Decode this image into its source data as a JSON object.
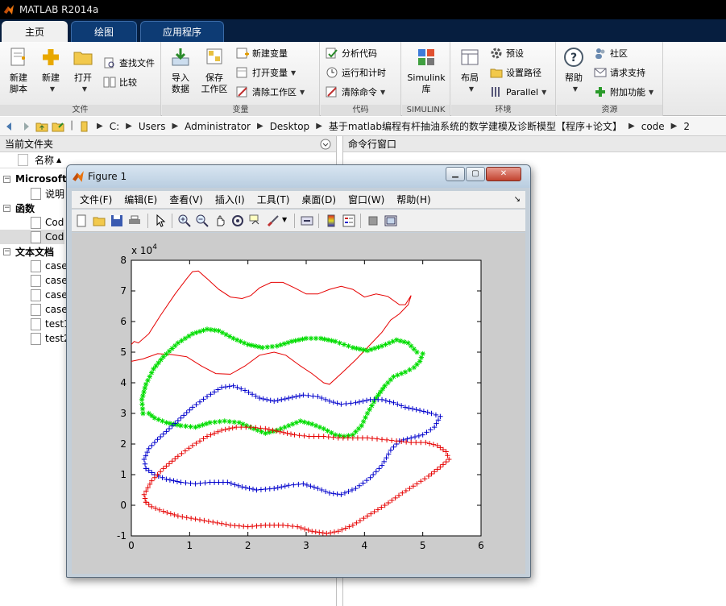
{
  "app": {
    "title": "MATLAB R2014a"
  },
  "tabs": [
    {
      "label": "主页"
    },
    {
      "label": "绘图"
    },
    {
      "label": "应用程序"
    }
  ],
  "ribbon": {
    "file": {
      "label": "文件",
      "new_script": [
        "新建",
        "脚本"
      ],
      "new": "新建",
      "open": "打开",
      "find_files": "查找文件",
      "compare": "比较"
    },
    "variable": {
      "label": "变量",
      "import": [
        "导入",
        "数据"
      ],
      "save": [
        "保存",
        "工作区"
      ],
      "new_var": "新建变量",
      "open_var": "打开变量",
      "clear_ws": "清除工作区"
    },
    "code": {
      "label": "代码",
      "analyze": "分析代码",
      "run_time": "运行和计时",
      "clear_cmd": "清除命令"
    },
    "simulink": {
      "label": "SIMULINK",
      "btn": [
        "Simulink",
        "库"
      ]
    },
    "env": {
      "label": "环境",
      "layout": "布局",
      "prefs": "预设",
      "set_path": "设置路径",
      "parallel": "Parallel"
    },
    "resources": {
      "label": "资源",
      "help": "帮助",
      "community": "社区",
      "support": "请求支持",
      "addons": "附加功能"
    }
  },
  "address": {
    "crumbs": [
      "C:",
      "Users",
      "Administrator",
      "Desktop",
      "基于matlab编程有杆抽油系统的数学建模及诊断模型【程序+论文】",
      "code",
      "2"
    ]
  },
  "left_panel": {
    "title": "当前文件夹",
    "column": "名称",
    "rows": [
      {
        "label": "Microsoft",
        "bold": true,
        "level": 0
      },
      {
        "label": "说明",
        "level": 1
      },
      {
        "label": "函数",
        "bold": true,
        "level": 0
      },
      {
        "label": "Cod",
        "level": 1
      },
      {
        "label": "Cod",
        "level": 1,
        "selected": true
      },
      {
        "label": "文本文档",
        "bold": true,
        "level": 0
      },
      {
        "label": "case",
        "level": 1
      },
      {
        "label": "case",
        "level": 1
      },
      {
        "label": "case",
        "level": 1
      },
      {
        "label": "case",
        "level": 1
      },
      {
        "label": "test1",
        "level": 1
      },
      {
        "label": "test2",
        "level": 1
      }
    ]
  },
  "right_panel": {
    "title": "命令行窗口"
  },
  "figure": {
    "title": "Figure 1",
    "menu": [
      "文件(F)",
      "编辑(E)",
      "查看(V)",
      "插入(I)",
      "工具(T)",
      "桌面(D)",
      "窗口(W)",
      "帮助(H)"
    ],
    "toolbar_icons": [
      "new-figure-icon",
      "open-file-icon",
      "save-icon",
      "print-icon",
      "pointer-icon",
      "zoom-in-icon",
      "zoom-out-icon",
      "pan-icon",
      "rotate-icon",
      "data-cursor-icon",
      "brush-icon",
      "link-icon",
      "colorbar-icon",
      "legend-icon",
      "hide-plot-tools-icon",
      "show-plot-tools-icon"
    ]
  },
  "colors": {
    "red": "#e60000",
    "green": "#00dd00",
    "blue": "#0000cc",
    "matlab_orange": "#e8730f"
  },
  "chart_data": {
    "type": "line",
    "title": "",
    "xlabel": "",
    "ylabel": "",
    "y_exponent": "x 10^4",
    "xlim": [
      0,
      6
    ],
    "ylim": [
      -1,
      8
    ],
    "xticks": [
      0,
      1,
      2,
      3,
      4,
      5,
      6
    ],
    "yticks": [
      -1,
      0,
      1,
      2,
      3,
      4,
      5,
      6,
      7,
      8
    ],
    "grid": false,
    "series": [
      {
        "marker": "line",
        "color": "#e60000",
        "points": [
          [
            0,
            5.25
          ],
          [
            0.05,
            5.35
          ],
          [
            0.12,
            5.3
          ],
          [
            0.3,
            5.6
          ],
          [
            0.5,
            6.2
          ],
          [
            0.75,
            6.9
          ],
          [
            0.95,
            7.4
          ],
          [
            1.05,
            7.63
          ],
          [
            1.15,
            7.65
          ],
          [
            1.3,
            7.4
          ],
          [
            1.5,
            7.05
          ],
          [
            1.7,
            6.8
          ],
          [
            1.9,
            6.75
          ],
          [
            2.05,
            6.85
          ],
          [
            2.2,
            7.1
          ],
          [
            2.4,
            7.28
          ],
          [
            2.6,
            7.28
          ],
          [
            2.8,
            7.1
          ],
          [
            3.0,
            6.9
          ],
          [
            3.2,
            6.9
          ],
          [
            3.4,
            7.05
          ],
          [
            3.6,
            7.15
          ],
          [
            3.8,
            7.05
          ],
          [
            4.0,
            6.8
          ],
          [
            4.2,
            6.9
          ],
          [
            4.4,
            6.82
          ],
          [
            4.6,
            6.55
          ],
          [
            4.7,
            6.55
          ],
          [
            4.8,
            6.85
          ],
          [
            4.75,
            6.55
          ],
          [
            4.6,
            6.25
          ],
          [
            4.45,
            6.05
          ],
          [
            4.3,
            5.65
          ],
          [
            4.1,
            5.25
          ],
          [
            3.85,
            4.75
          ],
          [
            3.6,
            4.3
          ],
          [
            3.4,
            3.95
          ],
          [
            3.3,
            4.0
          ],
          [
            3.1,
            4.3
          ],
          [
            2.9,
            4.55
          ],
          [
            2.65,
            4.9
          ],
          [
            2.45,
            5.0
          ],
          [
            2.2,
            4.9
          ],
          [
            1.95,
            4.55
          ],
          [
            1.7,
            4.28
          ],
          [
            1.45,
            4.3
          ],
          [
            1.2,
            4.55
          ],
          [
            0.95,
            4.85
          ],
          [
            0.7,
            4.92
          ],
          [
            0.45,
            4.95
          ],
          [
            0.2,
            4.78
          ],
          [
            0,
            4.7
          ]
        ]
      },
      {
        "marker": "asterisk",
        "color": "#00dd00",
        "points": [
          [
            0.2,
            3.0
          ],
          [
            0.3,
            3.0
          ],
          [
            0.4,
            2.85
          ],
          [
            0.6,
            2.7
          ],
          [
            0.85,
            2.6
          ],
          [
            1.1,
            2.55
          ],
          [
            1.35,
            2.7
          ],
          [
            1.6,
            2.75
          ],
          [
            1.85,
            2.7
          ],
          [
            2.1,
            2.5
          ],
          [
            2.3,
            2.35
          ],
          [
            2.5,
            2.45
          ],
          [
            2.7,
            2.6
          ],
          [
            2.9,
            2.75
          ],
          [
            3.1,
            2.65
          ],
          [
            3.3,
            2.5
          ],
          [
            3.5,
            2.3
          ],
          [
            3.65,
            2.25
          ],
          [
            3.8,
            2.3
          ],
          [
            3.95,
            2.6
          ],
          [
            4.05,
            3.0
          ],
          [
            4.2,
            3.5
          ],
          [
            4.35,
            3.9
          ],
          [
            4.5,
            4.2
          ],
          [
            4.7,
            4.35
          ],
          [
            4.85,
            4.5
          ],
          [
            4.95,
            4.7
          ],
          [
            5.0,
            4.95
          ],
          [
            4.9,
            5.0
          ],
          [
            4.75,
            5.3
          ],
          [
            4.55,
            5.4
          ],
          [
            4.3,
            5.2
          ],
          [
            4.05,
            5.05
          ],
          [
            3.8,
            5.15
          ],
          [
            3.5,
            5.35
          ],
          [
            3.25,
            5.45
          ],
          [
            3.0,
            5.45
          ],
          [
            2.75,
            5.35
          ],
          [
            2.5,
            5.2
          ],
          [
            2.25,
            5.15
          ],
          [
            2.0,
            5.25
          ],
          [
            1.75,
            5.45
          ],
          [
            1.5,
            5.7
          ],
          [
            1.3,
            5.75
          ],
          [
            1.05,
            5.6
          ],
          [
            0.8,
            5.3
          ],
          [
            0.55,
            4.85
          ],
          [
            0.38,
            4.45
          ],
          [
            0.25,
            3.95
          ],
          [
            0.18,
            3.45
          ],
          [
            0.2,
            3.0
          ]
        ]
      },
      {
        "marker": "plus",
        "color": "#0000cc",
        "points": [
          [
            0.25,
            1.2
          ],
          [
            0.22,
            1.5
          ],
          [
            0.3,
            1.85
          ],
          [
            0.45,
            2.15
          ],
          [
            0.65,
            2.5
          ],
          [
            0.85,
            2.85
          ],
          [
            1.05,
            3.2
          ],
          [
            1.3,
            3.55
          ],
          [
            1.55,
            3.85
          ],
          [
            1.75,
            3.9
          ],
          [
            1.95,
            3.75
          ],
          [
            2.2,
            3.5
          ],
          [
            2.45,
            3.4
          ],
          [
            2.7,
            3.5
          ],
          [
            2.95,
            3.6
          ],
          [
            3.2,
            3.55
          ],
          [
            3.4,
            3.4
          ],
          [
            3.6,
            3.3
          ],
          [
            3.85,
            3.35
          ],
          [
            4.1,
            3.45
          ],
          [
            4.3,
            3.45
          ],
          [
            4.5,
            3.35
          ],
          [
            4.7,
            3.2
          ],
          [
            4.95,
            3.1
          ],
          [
            5.15,
            3.0
          ],
          [
            5.3,
            2.9
          ],
          [
            5.2,
            2.55
          ],
          [
            5.0,
            2.3
          ],
          [
            4.8,
            2.2
          ],
          [
            4.6,
            2.1
          ],
          [
            4.45,
            1.8
          ],
          [
            4.3,
            1.3
          ],
          [
            4.1,
            0.9
          ],
          [
            3.85,
            0.55
          ],
          [
            3.6,
            0.35
          ],
          [
            3.4,
            0.4
          ],
          [
            3.2,
            0.55
          ],
          [
            2.95,
            0.7
          ],
          [
            2.7,
            0.65
          ],
          [
            2.45,
            0.55
          ],
          [
            2.15,
            0.5
          ],
          [
            1.9,
            0.6
          ],
          [
            1.65,
            0.75
          ],
          [
            1.35,
            0.75
          ],
          [
            1.1,
            0.7
          ],
          [
            0.85,
            0.75
          ],
          [
            0.6,
            0.85
          ],
          [
            0.4,
            1.0
          ],
          [
            0.25,
            1.2
          ]
        ]
      },
      {
        "marker": "plus",
        "color": "#e60000",
        "points": [
          [
            0.25,
            0.1
          ],
          [
            0.22,
            0.35
          ],
          [
            0.35,
            0.8
          ],
          [
            0.55,
            1.2
          ],
          [
            0.8,
            1.6
          ],
          [
            1.05,
            1.95
          ],
          [
            1.3,
            2.25
          ],
          [
            1.55,
            2.45
          ],
          [
            1.8,
            2.55
          ],
          [
            2.05,
            2.55
          ],
          [
            2.3,
            2.5
          ],
          [
            2.55,
            2.4
          ],
          [
            2.8,
            2.3
          ],
          [
            3.05,
            2.25
          ],
          [
            3.3,
            2.25
          ],
          [
            3.55,
            2.2
          ],
          [
            3.8,
            2.2
          ],
          [
            4.05,
            2.2
          ],
          [
            4.3,
            2.15
          ],
          [
            4.55,
            2.1
          ],
          [
            4.8,
            2.05
          ],
          [
            5.05,
            2.05
          ],
          [
            5.25,
            1.95
          ],
          [
            5.4,
            1.75
          ],
          [
            5.45,
            1.5
          ],
          [
            5.3,
            1.25
          ],
          [
            5.1,
            0.95
          ],
          [
            4.9,
            0.7
          ],
          [
            4.65,
            0.4
          ],
          [
            4.35,
            0.0
          ],
          [
            4.05,
            -0.35
          ],
          [
            3.8,
            -0.65
          ],
          [
            3.55,
            -0.85
          ],
          [
            3.35,
            -0.92
          ],
          [
            3.1,
            -0.85
          ],
          [
            2.85,
            -0.7
          ],
          [
            2.6,
            -0.65
          ],
          [
            2.3,
            -0.65
          ],
          [
            2.0,
            -0.7
          ],
          [
            1.7,
            -0.65
          ],
          [
            1.4,
            -0.55
          ],
          [
            1.1,
            -0.45
          ],
          [
            0.8,
            -0.35
          ],
          [
            0.55,
            -0.2
          ],
          [
            0.35,
            -0.05
          ],
          [
            0.25,
            0.1
          ]
        ]
      }
    ]
  }
}
